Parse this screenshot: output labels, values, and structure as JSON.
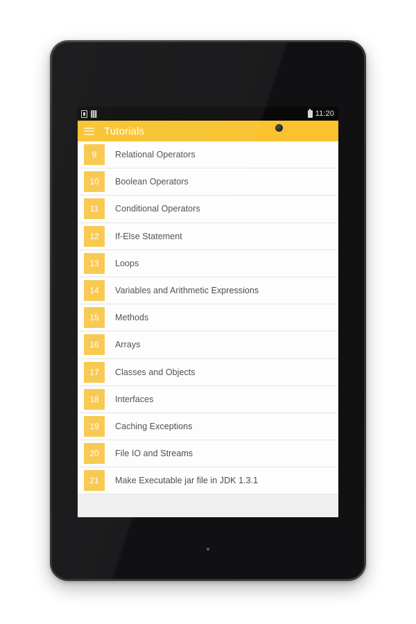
{
  "device": {
    "frame_color": "#343436",
    "screen_background": "#efefef",
    "camera_icon": "front-camera",
    "led_icon": "notification-led"
  },
  "status_bar": {
    "background": "#090909",
    "left_icons": [
      "sim-card-icon",
      "signal-bars-icon"
    ],
    "right_icons": [
      "battery-icon"
    ],
    "time": "11:20"
  },
  "app_bar": {
    "background": "#f9c22e",
    "menu_icon": "hamburger-menu-icon",
    "title": "Tutorials",
    "title_color": "#ffffff"
  },
  "list": {
    "badge_color": "#f8c74b",
    "badge_text_color": "#ffffff",
    "row_background": "#fdfdfd",
    "divider_color": "#e4e4e4",
    "label_color": "#4a4a4a",
    "items": [
      {
        "number": "9",
        "label": "Relational Operators"
      },
      {
        "number": "10",
        "label": "Boolean Operators"
      },
      {
        "number": "11",
        "label": "Conditional Operators"
      },
      {
        "number": "12",
        "label": "If-Else Statement"
      },
      {
        "number": "13",
        "label": "Loops"
      },
      {
        "number": "14",
        "label": "Variables and Arithmetic Expressions"
      },
      {
        "number": "15",
        "label": "Methods"
      },
      {
        "number": "16",
        "label": "Arrays"
      },
      {
        "number": "17",
        "label": "Classes and Objects"
      },
      {
        "number": "18",
        "label": "Interfaces"
      },
      {
        "number": "19",
        "label": "Caching Exceptions"
      },
      {
        "number": "20",
        "label": "File IO and Streams"
      },
      {
        "number": "21",
        "label": "Make Executable jar file in JDK 1.3.1"
      }
    ]
  },
  "nav_bar": {
    "background": "#050505",
    "buttons": [
      {
        "icon": "back-icon"
      },
      {
        "icon": "home-icon"
      },
      {
        "icon": "recents-icon"
      }
    ]
  }
}
